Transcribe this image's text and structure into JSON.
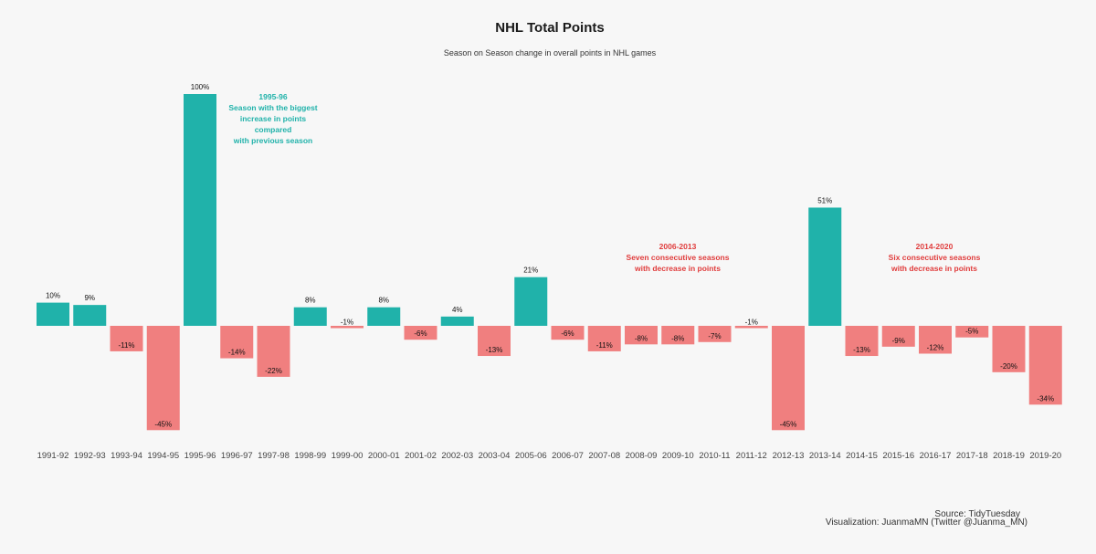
{
  "colors": {
    "background": "#f7f7f7",
    "positive": "#20b2aa",
    "negative": "#f07f7f",
    "annotation_positive": "#20b2aa",
    "annotation_negative": "#e03c3c"
  },
  "chart_data": {
    "type": "bar",
    "title": "NHL Total Points",
    "subtitle": "Season on Season change in overall points in NHL games",
    "xlabel": "",
    "ylabel": "",
    "grid": false,
    "legend": "none",
    "unit_suffix": "%",
    "categories": [
      "1991-92",
      "1992-93",
      "1993-94",
      "1994-95",
      "1995-96",
      "1996-97",
      "1997-98",
      "1998-99",
      "1999-00",
      "2000-01",
      "2001-02",
      "2002-03",
      "2003-04",
      "2005-06",
      "2006-07",
      "2007-08",
      "2008-09",
      "2009-10",
      "2010-11",
      "2011-12",
      "2012-13",
      "2013-14",
      "2014-15",
      "2015-16",
      "2016-17",
      "2017-18",
      "2018-19",
      "2019-20"
    ],
    "values": [
      10,
      9,
      -11,
      -45,
      100,
      -14,
      -22,
      8,
      -1,
      8,
      -6,
      4,
      -13,
      21,
      -6,
      -11,
      -8,
      -8,
      -7,
      -1,
      -45,
      51,
      -13,
      -9,
      -12,
      -5,
      -20,
      -34
    ],
    "ylim": [
      -50,
      100
    ],
    "annotations": [
      {
        "kind": "positive",
        "lines": [
          "1995-96",
          "Season with the biggest",
          "increase in points",
          "compared",
          "with previous season"
        ]
      },
      {
        "kind": "negative",
        "lines": [
          "2006-2013",
          "Seven consecutive seasons",
          "with decrease in points"
        ]
      },
      {
        "kind": "negative",
        "lines": [
          "2014-2020",
          "Six consecutive seasons",
          "with decrease in points"
        ]
      }
    ]
  },
  "caption": {
    "source": "Source: TidyTuesday",
    "credit": "Visualization: JuanmaMN (Twitter @Juanma_MN)"
  }
}
